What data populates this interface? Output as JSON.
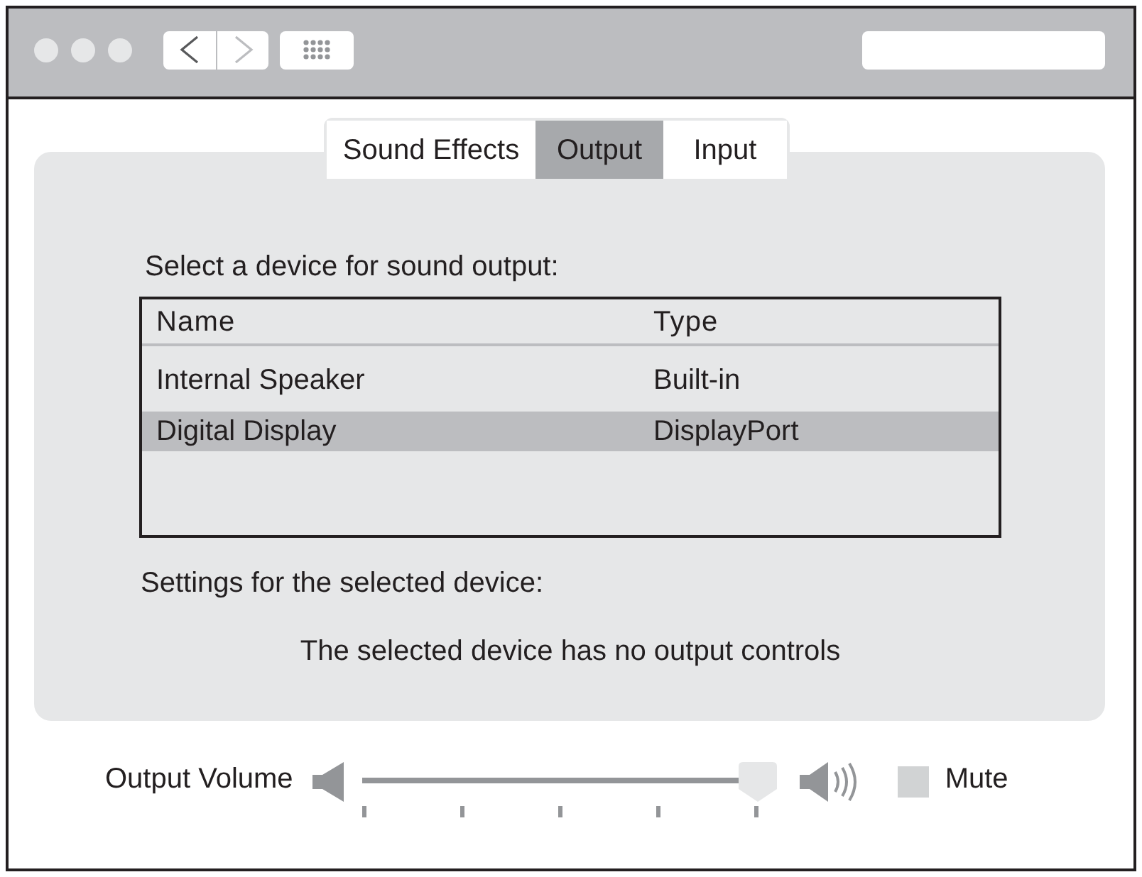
{
  "window": {
    "nav_buttons": [
      {
        "kind": "back",
        "disabled": false
      },
      {
        "kind": "forward",
        "disabled": true
      }
    ]
  },
  "tabs": [
    {
      "label": "Sound Effects",
      "selected": false
    },
    {
      "label": "Output",
      "selected": true
    },
    {
      "label": "Input",
      "selected": false
    }
  ],
  "output_device": {
    "prompt": "Select a device for sound output:",
    "table": {
      "columns": [
        "Name",
        "Type"
      ],
      "rows": [
        {
          "cells": [
            "Internal Speaker",
            "Built-in"
          ],
          "selected": false
        },
        {
          "cells": [
            "Digital Display",
            "DisplayPort"
          ],
          "selected": true
        }
      ]
    }
  },
  "device_settings": {
    "heading": "Settings for the selected device:",
    "message": "The selected device has no output controls"
  },
  "volume": {
    "label": "Output Volume",
    "level": 1,
    "mute": {
      "label": "Mute",
      "checked": false
    }
  }
}
